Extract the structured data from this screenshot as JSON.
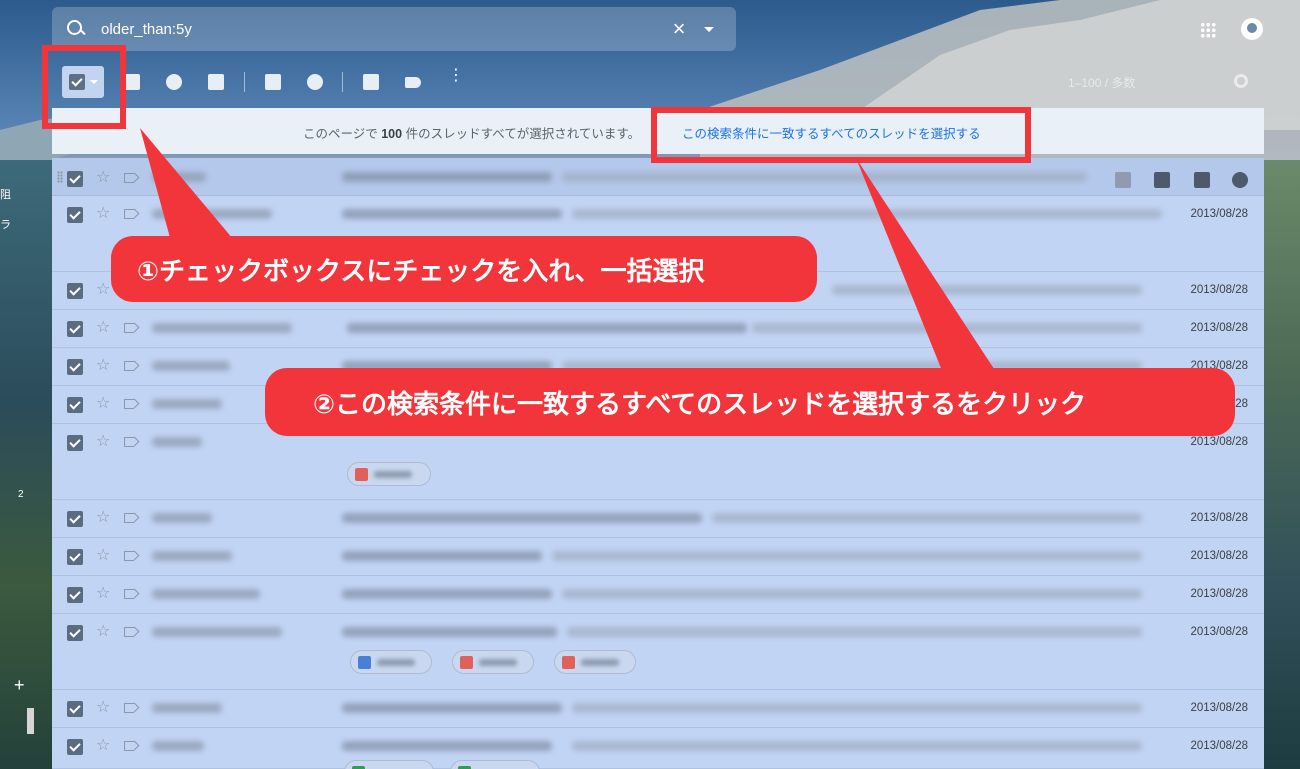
{
  "search": {
    "query": "older_than:5y"
  },
  "toolbar": {
    "pager": "1–100 / 多数"
  },
  "banner": {
    "prefix": "このページで ",
    "count": "100",
    "suffix": " 件のスレッドすべてが選択されています。",
    "select_all_link": "この検索条件に一致するすべてのスレッドを選択する"
  },
  "left_nav": {
    "label_a": "阻",
    "label_b": "ラ",
    "count_2": "2",
    "plus": "+"
  },
  "rows": [
    {
      "date": ""
    },
    {
      "date": "2013/08/28"
    },
    {
      "date": "2013/08/28"
    },
    {
      "date": "2013/08/28"
    },
    {
      "date": "2013/08/28"
    },
    {
      "date": "2013/08/28"
    },
    {
      "date": "2013/08/28"
    },
    {
      "date": "2013/08/28"
    },
    {
      "date": "2013/08/28"
    },
    {
      "date": "2013/08/28"
    },
    {
      "date": "2013/08/28"
    },
    {
      "date": "2013/08/28"
    },
    {
      "date": "2013/08/28"
    }
  ],
  "annotations": {
    "step1": "①チェックボックスにチェックを入れ、一括選択",
    "step2": "②この検索条件に一致するすべてのスレッドを選択するをクリック"
  },
  "colors": {
    "callout_red": "#f2343b",
    "selected_row_bg": "#c2d4f4",
    "link_blue": "#1a73e8"
  }
}
